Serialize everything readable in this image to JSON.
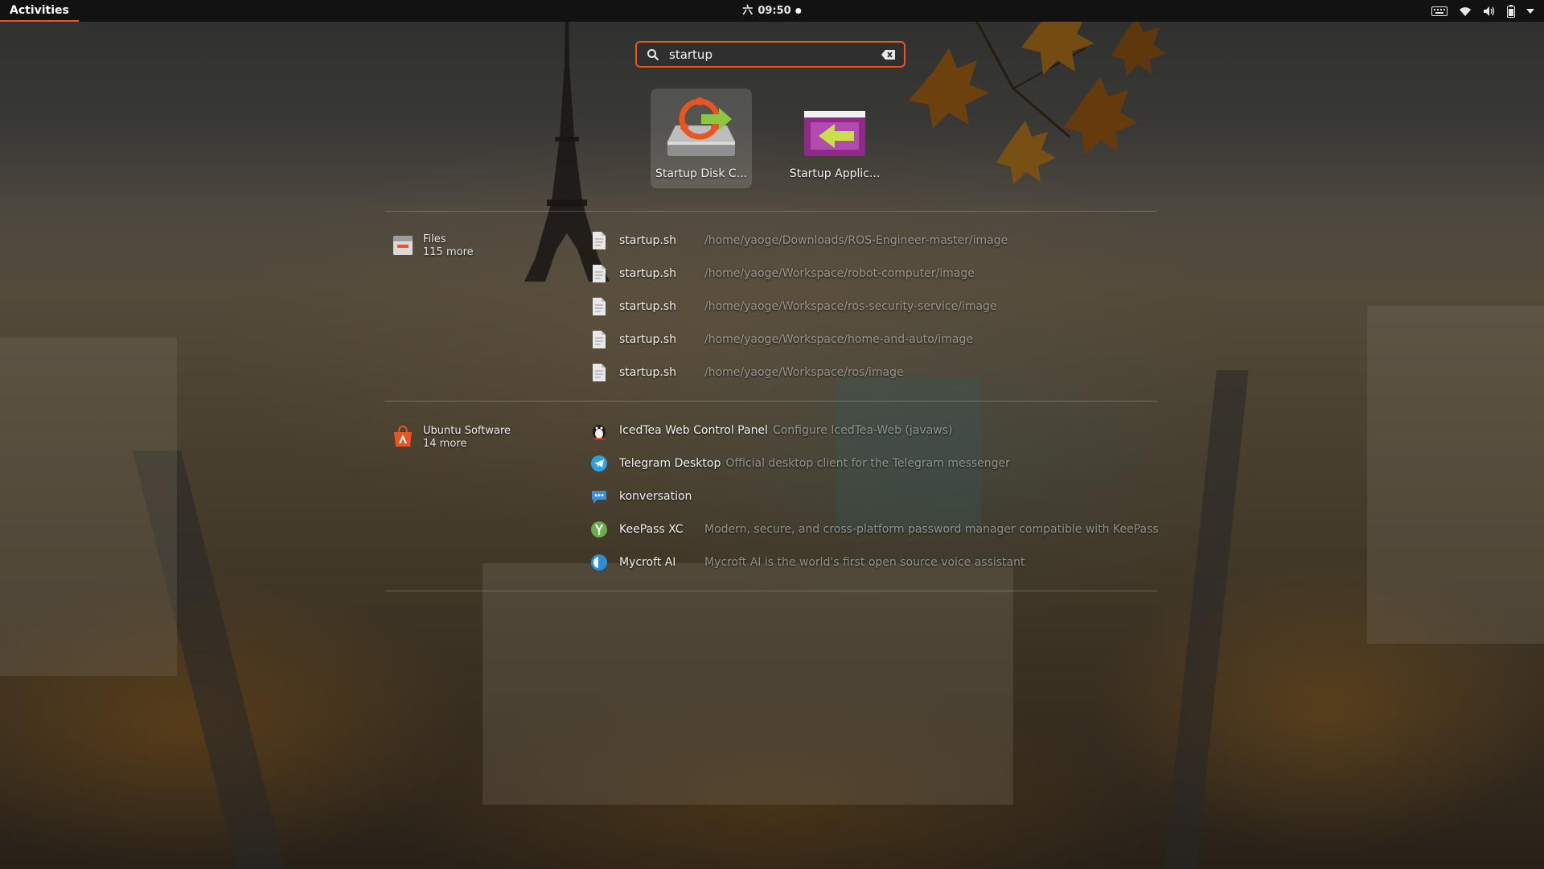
{
  "topbar": {
    "activities_label": "Activities",
    "clock_prefix": "六",
    "clock_time": "09:50"
  },
  "tray": {
    "icons": [
      "keyboard-icon",
      "wifi-icon",
      "volume-icon",
      "battery-icon",
      "chevron-down-icon"
    ]
  },
  "search": {
    "value": "startup",
    "placeholder": ""
  },
  "app_results": [
    {
      "label": "Startup Disk C...",
      "icon": "startup-disk-creator-icon",
      "selected": true
    },
    {
      "label": "Startup Applic...",
      "icon": "startup-applications-icon",
      "selected": false
    }
  ],
  "files_provider": {
    "title": "Files",
    "more": "115 more",
    "results": [
      {
        "name": "startup.sh",
        "desc": "/home/yaoge/Downloads/ROS-Engineer-master/image"
      },
      {
        "name": "startup.sh",
        "desc": "/home/yaoge/Workspace/robot-computer/image"
      },
      {
        "name": "startup.sh",
        "desc": "/home/yaoge/Workspace/ros-security-service/image"
      },
      {
        "name": "startup.sh",
        "desc": "/home/yaoge/Workspace/home-and-auto/image"
      },
      {
        "name": "startup.sh",
        "desc": "/home/yaoge/Workspace/ros/image"
      }
    ]
  },
  "software_provider": {
    "title": "Ubuntu Software",
    "more": "14 more",
    "results": [
      {
        "name": "IcedTea Web Control Panel",
        "desc": "Configure IcedTea-Web (javaws)",
        "icon": "icedtea-icon"
      },
      {
        "name": "Telegram Desktop",
        "desc": "Official desktop client for the Telegram messenger",
        "icon": "telegram-icon"
      },
      {
        "name": "konversation",
        "desc": "",
        "icon": "konversation-icon"
      },
      {
        "name": "KeePass XC",
        "desc": "Modern, secure, and cross-platform password manager compatible with KeePass",
        "icon": "keepassxc-icon"
      },
      {
        "name": "Mycroft AI",
        "desc": "Mycroft AI is the world's first open source voice assistant",
        "icon": "mycroft-icon"
      }
    ]
  },
  "colors": {
    "accent": "#e95420",
    "topbar_bg": "#121212"
  }
}
